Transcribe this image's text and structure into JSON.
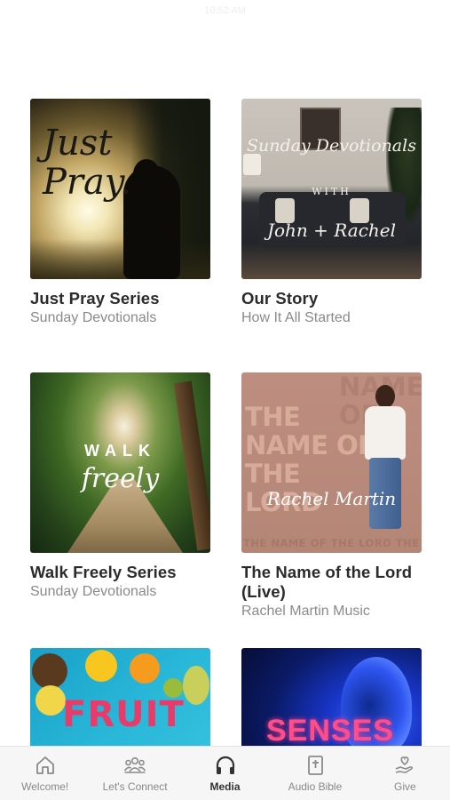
{
  "status_bar": {
    "faded_text": "10:52 AM"
  },
  "media_items": [
    {
      "title": "Just Pray Series",
      "subtitle": "Sunday Devotionals",
      "art_text": [
        "Just",
        "Pray."
      ]
    },
    {
      "title": "Our Story",
      "subtitle": "How It All Started",
      "art_text": [
        "Sunday Devotionals",
        "WITH",
        "John + Rachel"
      ]
    },
    {
      "title": "Walk Freely Series",
      "subtitle": "Sunday Devotionals",
      "art_text": [
        "WALK",
        "freely"
      ]
    },
    {
      "title": "The Name of the Lord (Live)",
      "subtitle": "Rachel Martin Music",
      "art_text": [
        "THE",
        "NAME OF THE",
        "LORD",
        "Rachel Martin",
        "NAME OF",
        "THE NAME OF THE LORD THE NAME"
      ]
    },
    {
      "title": "",
      "subtitle": "",
      "art_text": [
        "FRUIT"
      ]
    },
    {
      "title": "",
      "subtitle": "",
      "art_text": [
        "SENSES"
      ]
    }
  ],
  "tab_bar": {
    "items": [
      {
        "label": "Welcome!",
        "icon": "home-icon"
      },
      {
        "label": "Let's Connect",
        "icon": "people-icon"
      },
      {
        "label": "Media",
        "icon": "headphones-icon"
      },
      {
        "label": "Audio Bible",
        "icon": "bible-icon"
      },
      {
        "label": "Give",
        "icon": "give-hand-icon"
      }
    ],
    "active_index": 2
  },
  "colors": {
    "title": "#2b2b2b",
    "subtitle": "#8a8a8a",
    "tab_inactive": "#888888",
    "tab_active": "#333333",
    "tabbar_bg": "#f6f6f6"
  }
}
